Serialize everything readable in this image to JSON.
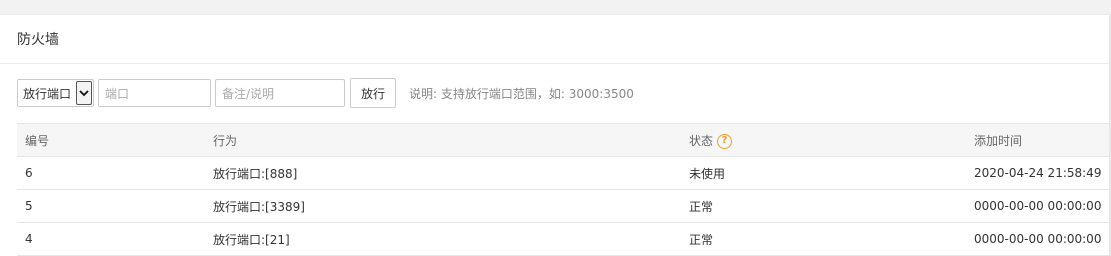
{
  "panel": {
    "title": "防火墙"
  },
  "toolbar": {
    "select_value": "放行端口",
    "port_placeholder": "端口",
    "note_placeholder": "备注/说明",
    "submit_label": "放行",
    "hint": "说明: 支持放行端口范围，如: 3000:3500"
  },
  "table": {
    "headers": {
      "id": "编号",
      "action": "行为",
      "status": "状态",
      "time": "添加时间"
    },
    "rows": [
      {
        "id": "6",
        "action": "放行端口:[888]",
        "status": "未使用",
        "time": "2020-04-24 21:58:49"
      },
      {
        "id": "5",
        "action": "放行端口:[3389]",
        "status": "正常",
        "time": "0000-00-00 00:00:00"
      },
      {
        "id": "4",
        "action": "放行端口:[21]",
        "status": "正常",
        "time": "0000-00-00 00:00:00"
      }
    ]
  },
  "icons": {
    "status_help": "question-circle-icon",
    "select_arrow": "chevron-down-icon"
  },
  "colors": {
    "help_icon": "#f0a020",
    "header_bg": "#f6f6f6"
  }
}
